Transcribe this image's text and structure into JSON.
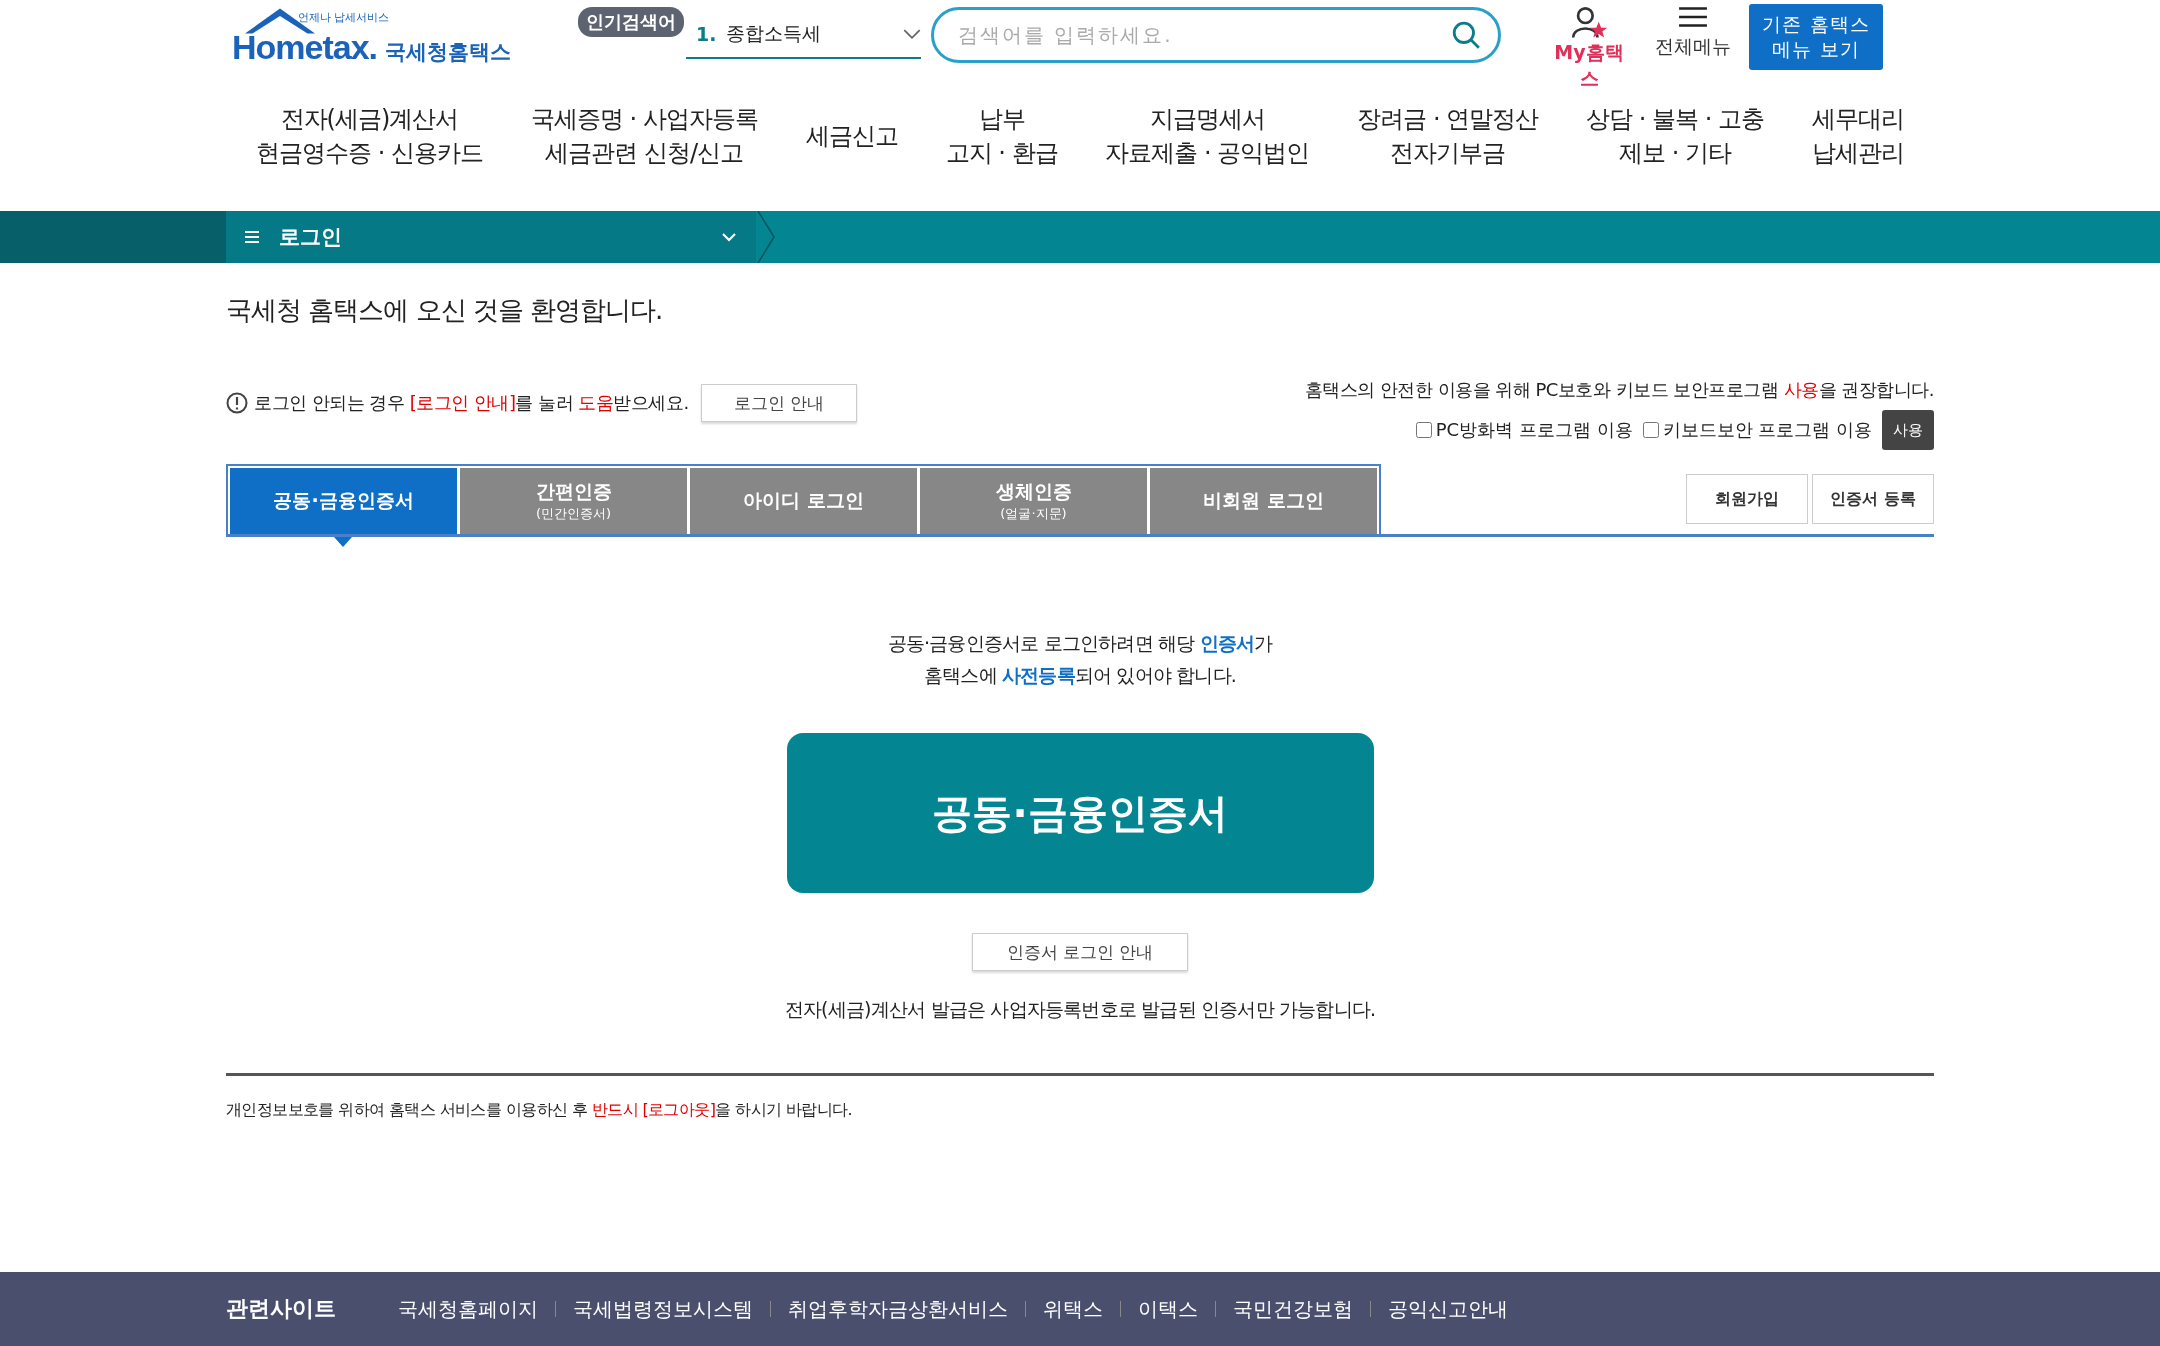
{
  "header": {
    "logo": {
      "tagline": "언제나 납세서비스",
      "wordmark": "Hometax.",
      "name": "국세청홈택스"
    },
    "popular_badge": "인기검색어",
    "popular_rank": "1.",
    "popular_term": "종합소득세",
    "search": {
      "placeholder": "검색어를 입력하세요."
    },
    "my_hometax": "My홈택스",
    "all_menu": "전체메뉴",
    "legacy_button": "기존 홈택스\n메뉴 보기"
  },
  "nav": [
    {
      "lines": [
        "전자(세금)계산서",
        "현금영수증 · 신용카드"
      ]
    },
    {
      "lines": [
        "국세증명 · 사업자등록",
        "세금관련 신청/신고"
      ]
    },
    {
      "lines": [
        "세금신고"
      ]
    },
    {
      "lines": [
        "납부",
        "고지 · 환급"
      ]
    },
    {
      "lines": [
        "지급명세서",
        "자료제출 · 공익법인"
      ]
    },
    {
      "lines": [
        "장려금 · 연말정산",
        "전자기부금"
      ]
    },
    {
      "lines": [
        "상담 · 불복 · 고충",
        "제보 · 기타"
      ]
    },
    {
      "lines": [
        "세무대리",
        "납세관리"
      ]
    }
  ],
  "breadcrumb": {
    "title": "로그인"
  },
  "welcome": "국세청 홈택스에 오신 것을 환영합니다.",
  "help": {
    "segments": [
      {
        "text": "로그인 안되는 경우 ",
        "kind": "plain"
      },
      {
        "text": "[로그인 안내]",
        "kind": "alert"
      },
      {
        "text": "를 눌러 ",
        "kind": "plain"
      },
      {
        "text": "도움",
        "kind": "alert"
      },
      {
        "text": "받으세요.",
        "kind": "plain"
      }
    ],
    "button": "로그인 안내"
  },
  "security": {
    "segments": [
      {
        "text": "홈택스의 안전한 이용을 위해 PC보호와 키보드 보안프로그램 ",
        "kind": "plain"
      },
      {
        "text": "사용",
        "kind": "alert"
      },
      {
        "text": "을 권장합니다.",
        "kind": "plain"
      }
    ],
    "options": [
      {
        "label": "PC방화벽 프로그램 이용",
        "checked": false
      },
      {
        "label": "키보드보안 프로그램 이용",
        "checked": false
      }
    ],
    "button": "사용"
  },
  "tabs": [
    {
      "label": "공동·금융인증서",
      "selected": true
    },
    {
      "label": "간편인증",
      "sub": "(민간인증서)",
      "selected": false
    },
    {
      "label": "아이디 로그인",
      "selected": false
    },
    {
      "label": "생체인증",
      "sub": "(얼굴·지문)",
      "selected": false
    },
    {
      "label": "비회원 로그인",
      "selected": false
    }
  ],
  "side_buttons": [
    "회원가입",
    "인증서 등록"
  ],
  "intro": [
    {
      "segments": [
        {
          "text": "공동·금융인증서로 로그인하려면 해당 ",
          "kind": "plain"
        },
        {
          "text": "인증서",
          "kind": "link"
        },
        {
          "text": "가",
          "kind": "plain"
        }
      ]
    },
    {
      "segments": [
        {
          "text": "홈택스에 ",
          "kind": "plain"
        },
        {
          "text": "사전등록",
          "kind": "link"
        },
        {
          "text": "되어 있어야 합니다.",
          "kind": "plain"
        }
      ]
    }
  ],
  "main_button": "공동·금융인증서",
  "guide_button": "인증서 로그인 안내",
  "notice": "전자(세금)계산서 발급은 사업자등록번호로 발급된 인증서만 가능합니다.",
  "footnote": {
    "segments": [
      {
        "text": "개인정보보호를 위하여 홈택스 서비스를 이용하신 후 ",
        "kind": "plain"
      },
      {
        "text": "반드시 [로그아웃]",
        "kind": "alert"
      },
      {
        "text": "을 하시기 바랍니다.",
        "kind": "plain"
      }
    ]
  },
  "footer": {
    "title": "관련사이트",
    "links": [
      "국세청홈페이지",
      "국세법령정보시스템",
      "취업후학자금상환서비스",
      "위택스",
      "이택스",
      "국민건강보험",
      "공익신고안내"
    ]
  }
}
